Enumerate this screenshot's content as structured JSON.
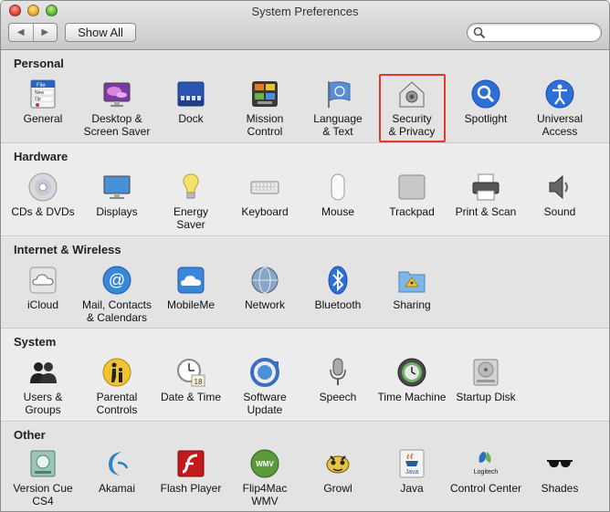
{
  "window": {
    "title": "System Preferences"
  },
  "toolbar": {
    "back_label": "◀",
    "forward_label": "▶",
    "show_all_label": "Show All",
    "search_value": "",
    "search_placeholder": ""
  },
  "sections": [
    {
      "title": "Personal",
      "items": [
        {
          "label": "General"
        },
        {
          "label": "Desktop &\nScreen Saver"
        },
        {
          "label": "Dock"
        },
        {
          "label": "Mission\nControl"
        },
        {
          "label": "Language\n& Text"
        },
        {
          "label": "Security\n& Privacy"
        },
        {
          "label": "Spotlight"
        },
        {
          "label": "Universal\nAccess"
        }
      ]
    },
    {
      "title": "Hardware",
      "items": [
        {
          "label": "CDs & DVDs"
        },
        {
          "label": "Displays"
        },
        {
          "label": "Energy\nSaver"
        },
        {
          "label": "Keyboard"
        },
        {
          "label": "Mouse"
        },
        {
          "label": "Trackpad"
        },
        {
          "label": "Print & Scan"
        },
        {
          "label": "Sound"
        }
      ]
    },
    {
      "title": "Internet & Wireless",
      "items": [
        {
          "label": "iCloud"
        },
        {
          "label": "Mail, Contacts\n& Calendars"
        },
        {
          "label": "MobileMe"
        },
        {
          "label": "Network"
        },
        {
          "label": "Bluetooth"
        },
        {
          "label": "Sharing"
        }
      ]
    },
    {
      "title": "System",
      "items": [
        {
          "label": "Users &\nGroups"
        },
        {
          "label": "Parental\nControls"
        },
        {
          "label": "Date & Time"
        },
        {
          "label": "Software\nUpdate"
        },
        {
          "label": "Speech"
        },
        {
          "label": "Time Machine"
        },
        {
          "label": "Startup Disk"
        }
      ]
    },
    {
      "title": "Other",
      "items": [
        {
          "label": "Version Cue\nCS4"
        },
        {
          "label": "Akamai"
        },
        {
          "label": "Flash Player"
        },
        {
          "label": "Flip4Mac\nWMV"
        },
        {
          "label": "Growl"
        },
        {
          "label": "Java"
        },
        {
          "label": "Control Center"
        },
        {
          "label": "Shades"
        }
      ]
    }
  ],
  "icons": {
    "general": "general-file-icon",
    "desktop": "desktop-icon",
    "dock": "dock-icon",
    "mission": "mission-control-icon",
    "language": "flag-icon",
    "security": "house-lock-icon",
    "spotlight": "magnifier-icon",
    "universal": "accessibility-icon",
    "java_text": "Java",
    "growl_text": "",
    "logitech_text": "Logitech",
    "wmv_text": "WMV",
    "date_day": "18"
  },
  "highlight": {
    "target": "Security & Privacy",
    "color": "#e03a2a"
  }
}
